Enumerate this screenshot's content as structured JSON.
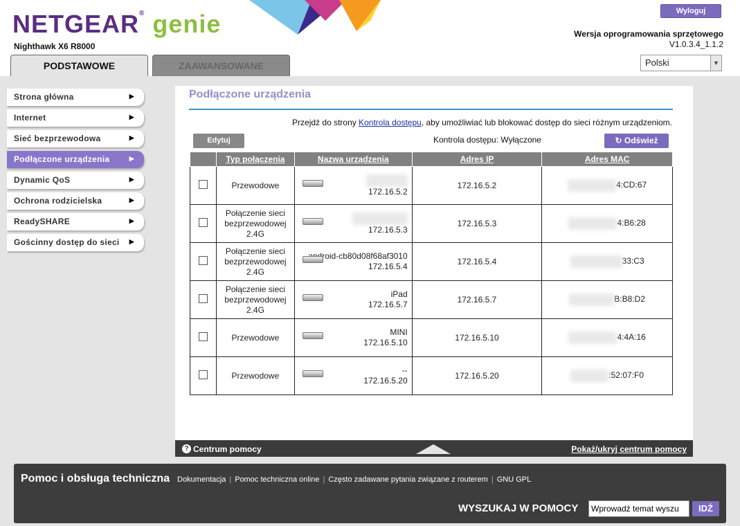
{
  "header": {
    "brand": "NETGEAR",
    "brand_suffix": "genie",
    "model": "Nighthawk X6 R8000",
    "logout_label": "Wyloguj",
    "firmware_label": "Wersja oprogramowania sprzętowego",
    "firmware_version": "V1.0.3.4_1.1.2",
    "language_selected": "Polski"
  },
  "tabs": [
    {
      "label": "PODSTAWOWE",
      "active": true
    },
    {
      "label": "ZAAWANSOWANE",
      "active": false
    }
  ],
  "sidebar": {
    "items": [
      {
        "label": "Strona główna"
      },
      {
        "label": "Internet"
      },
      {
        "label": "Sieć bezprzewodowa"
      },
      {
        "label": "Podłączone urządzenia",
        "active": true
      },
      {
        "label": "Dynamic QoS"
      },
      {
        "label": "Ochrona rodzicielska"
      },
      {
        "label": "ReadySHARE"
      },
      {
        "label": "Gościnny dostęp do sieci"
      }
    ]
  },
  "main": {
    "title": "Podłączone urządzenia",
    "intro_pre": "Przejdź do strony ",
    "intro_link": "Kontrola dostępu",
    "intro_post": ", aby umożliwiać lub blokować dostęp do sieci różnym urządzeniom.",
    "edit_label": "Edytuj",
    "access_status": "Kontrola dostępu: Wyłączone",
    "refresh_label": "Odśwież",
    "columns": [
      "Typ połączenia",
      "Nazwa urządzenia",
      "Adres IP",
      "Adres MAC"
    ],
    "rows": [
      {
        "type": "Przewodowe",
        "name": "",
        "name_ip": "172.16.5.2",
        "ip": "172.16.5.2",
        "mac": "4:CD:67"
      },
      {
        "type": "Połączenie sieci bezprzewodowej 2.4G",
        "name": "",
        "name_ip": "172.16.5.3",
        "ip": "172.16.5.3",
        "mac": "4:B6:28"
      },
      {
        "type": "Połączenie sieci bezprzewodowej 2.4G",
        "name": "android-cb80d08f68af3010",
        "name_ip": "172.16.5.4",
        "ip": "172.16.5.4",
        "mac": "33:C3"
      },
      {
        "type": "Połączenie sieci bezprzewodowej 2.4G",
        "name": "iPad",
        "name_ip": "172.16.5.7",
        "ip": "172.16.5.7",
        "mac": "B:B8:D2"
      },
      {
        "type": "Przewodowe",
        "name": "MINI",
        "name_ip": "172.16.5.10",
        "ip": "172.16.5.10",
        "mac": "4:4A:16"
      },
      {
        "type": "Przewodowe",
        "name": "--",
        "name_ip": "172.16.5.20",
        "ip": "172.16.5.20",
        "mac": ":52:07:F0"
      }
    ]
  },
  "help_bar": {
    "title": "Centrum pomocy",
    "toggle": "Pokaż/ukryj centrum pomocy"
  },
  "footer": {
    "title": "Pomoc i obsługa techniczna",
    "links": [
      "Dokumentacja",
      "Pomoc techniczna online",
      "Często zadawane pytania związane z routerem",
      "GNU GPL"
    ],
    "search_label": "WYSZUKAJ W POMOCY",
    "search_value": "Wprowadź temat wyszu",
    "search_button": "IDŹ"
  },
  "colors": {
    "accent": "#7b6bbd",
    "brand_purple": "#5a2d82",
    "genie_green": "#8cbf3f",
    "rule_blue": "#3a93c9"
  }
}
